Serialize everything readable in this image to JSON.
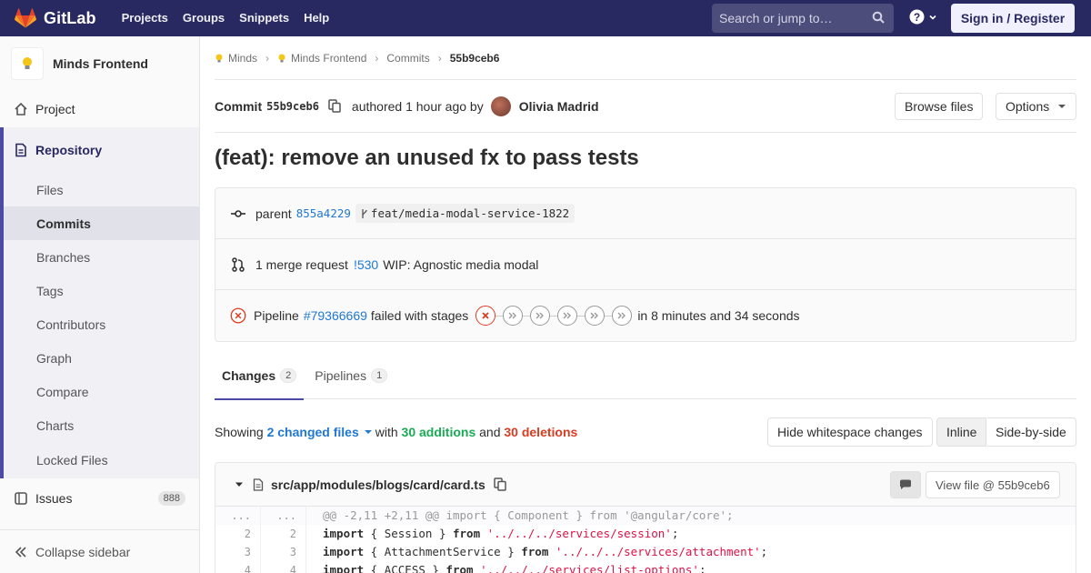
{
  "navbar": {
    "brand": "GitLab",
    "links": [
      "Projects",
      "Groups",
      "Snippets",
      "Help"
    ],
    "search_placeholder": "Search or jump to…",
    "signin_label": "Sign in / Register"
  },
  "sidebar": {
    "project_name": "Minds Frontend",
    "project_item": "Project",
    "repository_label": "Repository",
    "repo_items": [
      "Files",
      "Commits",
      "Branches",
      "Tags",
      "Contributors",
      "Graph",
      "Compare",
      "Charts",
      "Locked Files"
    ],
    "active_repo_item": "Commits",
    "issues_label": "Issues",
    "issues_count": "888",
    "collapse_label": "Collapse sidebar"
  },
  "breadcrumb": [
    "Minds",
    "Minds Frontend",
    "Commits",
    "55b9ceb6"
  ],
  "commit": {
    "label": "Commit",
    "sha": "55b9ceb6",
    "authored": "authored 1 hour ago by",
    "author": "Olivia Madrid",
    "browse_files": "Browse files",
    "options": "Options",
    "title": "(feat): remove an unused fx to pass tests"
  },
  "info": {
    "parent_label": "parent",
    "parent_sha": "855a4229",
    "branch": "feat/media-modal-service-1822",
    "mr_label": "1 merge request",
    "mr_id": "!530",
    "mr_title": "WIP: Agnostic media modal",
    "pipeline_label": "Pipeline",
    "pipeline_id": "#79366669",
    "pipeline_status": "failed with stages",
    "pipeline_duration": "in 8 minutes and 34 seconds"
  },
  "tabs": [
    {
      "label": "Changes",
      "count": "2"
    },
    {
      "label": "Pipelines",
      "count": "1"
    }
  ],
  "summary": {
    "showing": "Showing",
    "changed_files": "2 changed files",
    "with": "with",
    "additions": "30 additions",
    "and": "and",
    "deletions": "30 deletions",
    "hide_whitespace": "Hide whitespace changes",
    "inline": "Inline",
    "side_by_side": "Side-by-side"
  },
  "diff": {
    "file_path": "src/app/modules/blogs/card/card.ts",
    "view_file": "View file @ 55b9ceb6",
    "hunk_header": "@@ -2,11 +2,11 @@ import { Component } from '@angular/core';",
    "lines": [
      {
        "old": "2",
        "new": "2",
        "kw": "import",
        "mid": " { Session } ",
        "kw2": "from",
        "str": "'../../../services/session'",
        "end": ";"
      },
      {
        "old": "3",
        "new": "3",
        "kw": "import",
        "mid": " { AttachmentService } ",
        "kw2": "from",
        "str": "'../../../services/attachment'",
        "end": ";"
      },
      {
        "old": "4",
        "new": "4",
        "kw": "import",
        "mid": " { ACCESS } ",
        "kw2": "from",
        "str": "'../../../services/list-options'",
        "end": ";"
      }
    ]
  },
  "colors": {
    "navbar": "#292961",
    "link": "#1f78d1",
    "additions": "#1aaa55",
    "deletions": "#db3b21"
  }
}
